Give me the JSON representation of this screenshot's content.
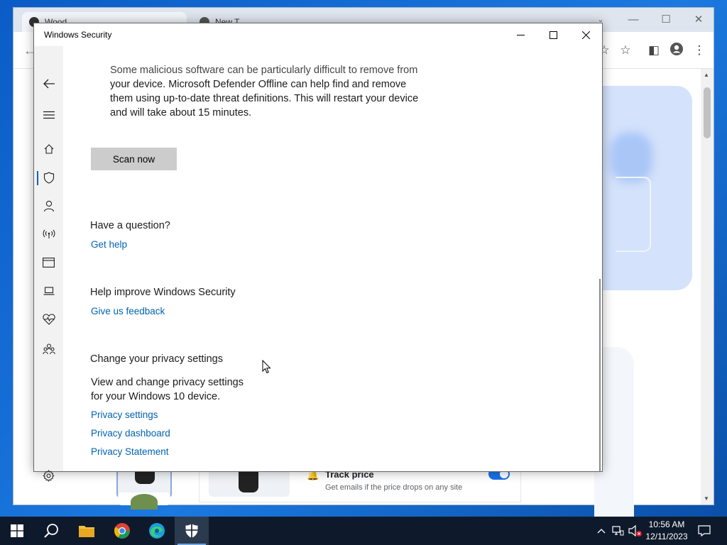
{
  "chrome": {
    "tabs": [
      {
        "label": "Wood"
      },
      {
        "label": "New T"
      }
    ],
    "product": {
      "track_title": "Track price",
      "track_subtitle": "Get emails if the price drops on any site"
    }
  },
  "windows_security": {
    "title": "Windows Security",
    "offline_scan": {
      "description_lines": [
        "Some malicious software can be particularly difficult to remove from",
        "your device. Microsoft Defender Offline can help find and remove",
        "them using up-to-date threat definitions. This will restart your device",
        "and will take about 15 minutes."
      ],
      "scan_button": "Scan now"
    },
    "question": {
      "heading": "Have a question?",
      "link": "Get help"
    },
    "improve": {
      "heading": "Help improve Windows Security",
      "link": "Give us feedback"
    },
    "privacy": {
      "heading": "Change your privacy settings",
      "description_lines": [
        "View and change privacy settings",
        "for your Windows 10 device."
      ],
      "links": [
        "Privacy settings",
        "Privacy dashboard",
        "Privacy Statement"
      ]
    },
    "nav": [
      {
        "icon": "back-arrow-icon"
      },
      {
        "icon": "hamburger-menu-icon"
      },
      {
        "icon": "home-icon"
      },
      {
        "icon": "shield-icon",
        "active": true
      },
      {
        "icon": "person-icon"
      },
      {
        "icon": "wireless-antenna-icon"
      },
      {
        "icon": "app-browser-icon"
      },
      {
        "icon": "laptop-icon"
      },
      {
        "icon": "heart-health-icon"
      },
      {
        "icon": "family-icon"
      },
      {
        "icon": "gear-icon"
      }
    ]
  },
  "taskbar": {
    "time": "10:56 AM",
    "date": "12/11/2023"
  },
  "colors": {
    "link": "#0063b1",
    "nav_active": "#0067b8",
    "taskbar": "#0e1a2b"
  }
}
